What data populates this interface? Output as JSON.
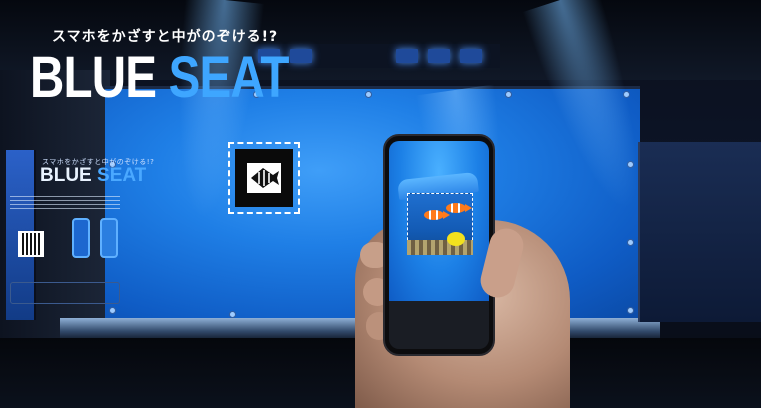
{
  "headline": {
    "subtitle": "スマホをかざすと中がのぞける!?",
    "title_word1": "BLUE",
    "title_word2": "SEAT"
  },
  "side_panel": {
    "subtitle": "スマホをかざすと中がのぞける!?",
    "title_word1": "BLUE",
    "title_word2": "SEAT"
  },
  "marker": {
    "icon": "angelfish-icon"
  },
  "phone": {
    "content_icons": [
      "clownfish-icon",
      "yellow-tang-icon",
      "coral-reef-icon"
    ]
  },
  "colors": {
    "wall_blue": "#1f7fe6",
    "accent_blue": "#3ea6ff",
    "text_white": "#ffffff"
  }
}
